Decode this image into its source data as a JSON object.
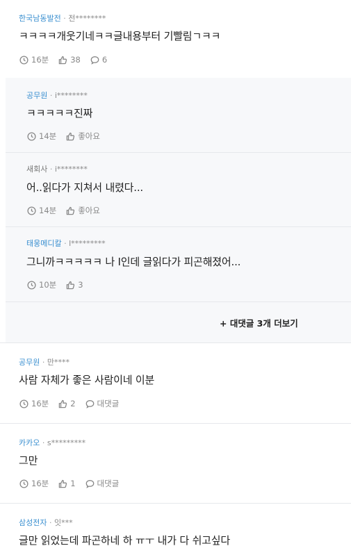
{
  "comments": [
    {
      "company": "한국남동발전",
      "user": "전********",
      "text": "ㅋㅋㅋㅋ개웃기네ㅋㅋ글내용부터 기빨림ㄱㅋㅋ",
      "time": "16분",
      "likes": "38",
      "replies": "6"
    }
  ],
  "replies": [
    {
      "company": "공무원",
      "user": "i********",
      "text": "ㅋㅋㅋㅋㅋ진짜",
      "time": "14분",
      "like_label": "좋아요"
    },
    {
      "company": "새회사",
      "user": "i********",
      "text": "어..읽다가 지쳐서 내렸다...",
      "time": "14분",
      "like_label": "좋아요"
    },
    {
      "company": "태웅메디칼",
      "user": "l*********",
      "text": "그니까ㅋㅋㅋㅋㅋ 나 I인데 글읽다가 피곤해졌어...",
      "time": "10분",
      "likes": "3"
    }
  ],
  "more_replies": "+ 대댓글 3개 더보기",
  "comments2": [
    {
      "company": "공무원",
      "user": "만****",
      "text": "사람 자체가 좋은 사람이네 이분",
      "time": "16분",
      "likes": "2",
      "reply_label": "대댓글"
    },
    {
      "company": "카카오",
      "user": "s*********",
      "text": "그만",
      "time": "16분",
      "likes": "1",
      "reply_label": "대댓글"
    },
    {
      "company": "삼성전자",
      "user": "잇***",
      "text": "글만 읽었는데 파곤하네 하 ㅠㅜ 내가 다 쉬고싶다"
    }
  ],
  "separator": "·",
  "colors": {
    "company": "#3a8fd0",
    "reply_bg": "#f7f8fa",
    "divider": "#e6e8eb"
  }
}
